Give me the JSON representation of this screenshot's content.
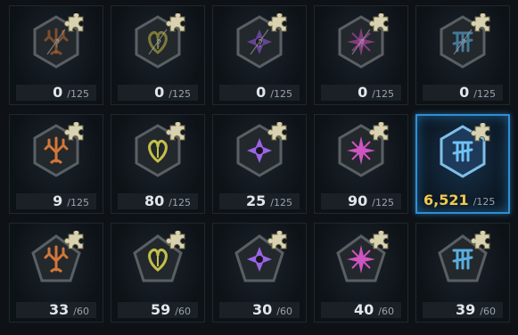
{
  "shards": [
    {
      "owned": "0",
      "required": "/125",
      "color": "#b8672e",
      "symbol": "tree-icon",
      "shape": "hex",
      "locked": true
    },
    {
      "owned": "0",
      "required": "/125",
      "color": "#b8b040",
      "symbol": "heart-icon",
      "shape": "hex",
      "locked": true
    },
    {
      "owned": "0",
      "required": "/125",
      "color": "#8e58d6",
      "symbol": "compass-icon",
      "shape": "hex",
      "locked": true
    },
    {
      "owned": "0",
      "required": "/125",
      "color": "#c04ab4",
      "symbol": "star-icon",
      "shape": "hex",
      "locked": true
    },
    {
      "owned": "0",
      "required": "/125",
      "color": "#58aee0",
      "symbol": "rune-icon",
      "shape": "hex",
      "locked": true
    },
    {
      "owned": "9",
      "required": "/125",
      "color": "#d2763a",
      "symbol": "tree-icon",
      "shape": "hex",
      "locked": false
    },
    {
      "owned": "80",
      "required": "/125",
      "color": "#c4c04a",
      "symbol": "heart-icon",
      "shape": "hex",
      "locked": false
    },
    {
      "owned": "25",
      "required": "/125",
      "color": "#9a64e6",
      "symbol": "compass-icon",
      "shape": "hex",
      "locked": false
    },
    {
      "owned": "90",
      "required": "/125",
      "color": "#cf55c2",
      "symbol": "star-icon",
      "shape": "hex",
      "locked": false
    },
    {
      "owned": "6,521",
      "required": "/125",
      "color": "#6ec2f4",
      "symbol": "rune-icon",
      "shape": "hex",
      "locked": false,
      "selected": true
    },
    {
      "owned": "33",
      "required": "/60",
      "color": "#d2763a",
      "symbol": "tree-icon",
      "shape": "pent",
      "locked": false
    },
    {
      "owned": "59",
      "required": "/60",
      "color": "#c4c04a",
      "symbol": "heart-icon",
      "shape": "pent",
      "locked": false
    },
    {
      "owned": "30",
      "required": "/60",
      "color": "#9a64e6",
      "symbol": "compass-icon",
      "shape": "pent",
      "locked": false
    },
    {
      "owned": "40",
      "required": "/60",
      "color": "#cf55c2",
      "symbol": "star-icon",
      "shape": "pent",
      "locked": false
    },
    {
      "owned": "39",
      "required": "/60",
      "color": "#58aee0",
      "symbol": "rune-icon",
      "shape": "pent",
      "locked": false
    }
  ],
  "colors": {
    "selected_border": "#2e8fd6",
    "puzzle_piece": "#d8d2b0",
    "frame": "#5a5f63"
  }
}
